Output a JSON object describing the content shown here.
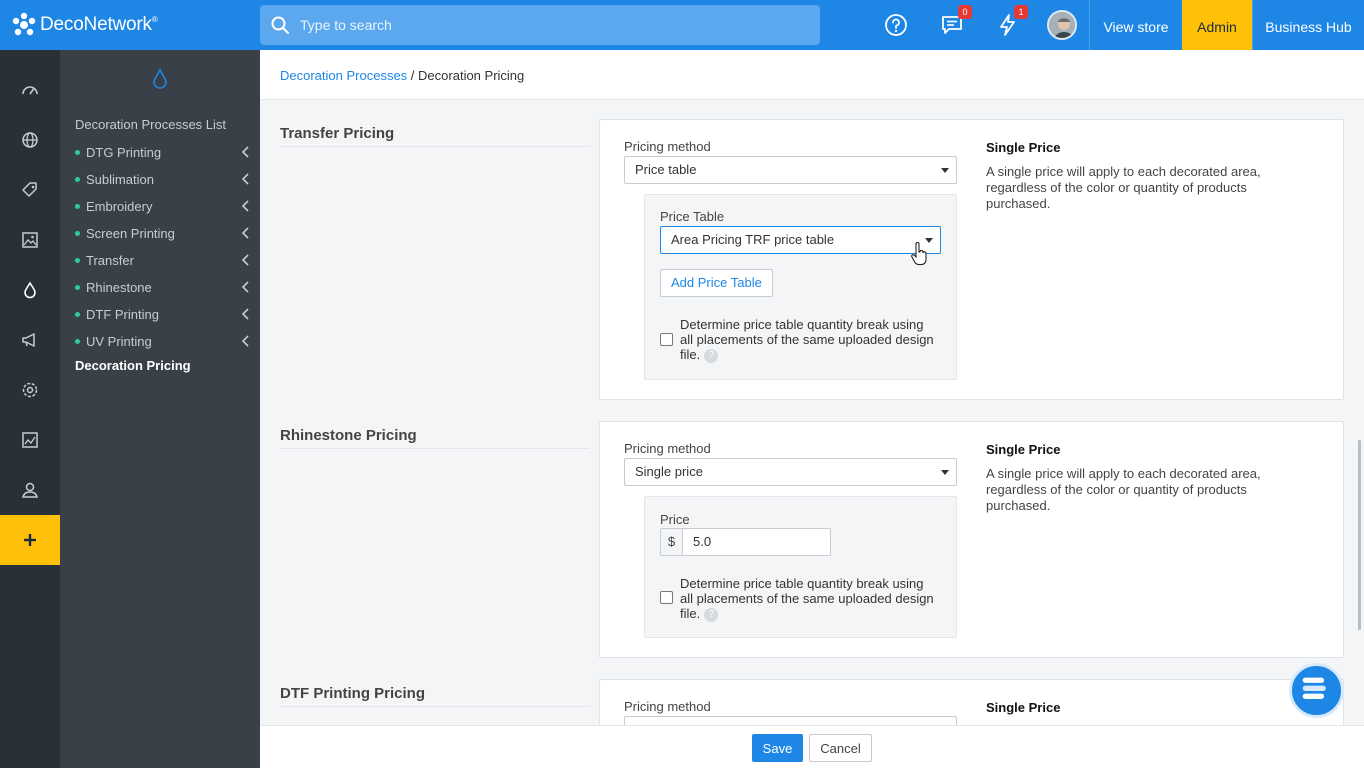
{
  "app": {
    "name": "DecoNetwork",
    "trademark": "®"
  },
  "search": {
    "placeholder": "Type to search"
  },
  "header": {
    "messages_count": "0",
    "notifications_count": "1",
    "links": {
      "view_store": "View store",
      "admin": "Admin",
      "business_hub": "Business Hub"
    }
  },
  "rail": {
    "icons": [
      "dashboard-icon",
      "globe-icon",
      "tag-icon",
      "image-icon",
      "droplet-icon",
      "megaphone-icon",
      "settings-icon",
      "reports-icon",
      "user-icon",
      "plus-icon"
    ],
    "add_label": "+"
  },
  "sidebar": {
    "title": "Decoration Processes List",
    "items": [
      {
        "label": "DTG Printing"
      },
      {
        "label": "Sublimation"
      },
      {
        "label": "Embroidery"
      },
      {
        "label": "Screen Printing"
      },
      {
        "label": "Transfer"
      },
      {
        "label": "Rhinestone"
      },
      {
        "label": "DTF Printing"
      },
      {
        "label": "UV Printing"
      }
    ],
    "active": "Decoration Pricing"
  },
  "breadcrumb": {
    "parent": "Decoration Processes",
    "separator": "/",
    "current": "Decoration Pricing"
  },
  "sections": {
    "transfer": {
      "title": "Transfer Pricing",
      "pricing_method_label": "Pricing method",
      "pricing_method_value": "Price table",
      "price_table_label": "Price Table",
      "price_table_value": "Area Pricing TRF price table",
      "add_price_table": "Add Price Table",
      "checkbox_text": "Determine price table quantity break using all placements of the same uploaded design file.",
      "help": "?",
      "side_title": "Single Price",
      "side_desc": "A single price will apply to each decorated area, regardless of the color or quantity of products purchased."
    },
    "rhinestone": {
      "title": "Rhinestone Pricing",
      "pricing_method_label": "Pricing method",
      "pricing_method_value": "Single price",
      "price_label": "Price",
      "currency": "$",
      "price_value": "5.0",
      "checkbox_text": "Determine price table quantity break using all placements of the same uploaded design file.",
      "help": "?",
      "side_title": "Single Price",
      "side_desc": "A single price will apply to each decorated area, regardless of the color or quantity of products purchased."
    },
    "dtf": {
      "title": "DTF Printing Pricing",
      "pricing_method_label": "Pricing method",
      "side_title": "Single Price"
    }
  },
  "footer": {
    "save": "Save",
    "cancel": "Cancel"
  },
  "colors": {
    "primary": "#1e87e5",
    "admin": "#ffc107",
    "rail": "#2a3038",
    "sidebar": "#3a4048",
    "dot": "#2ecc9a"
  }
}
